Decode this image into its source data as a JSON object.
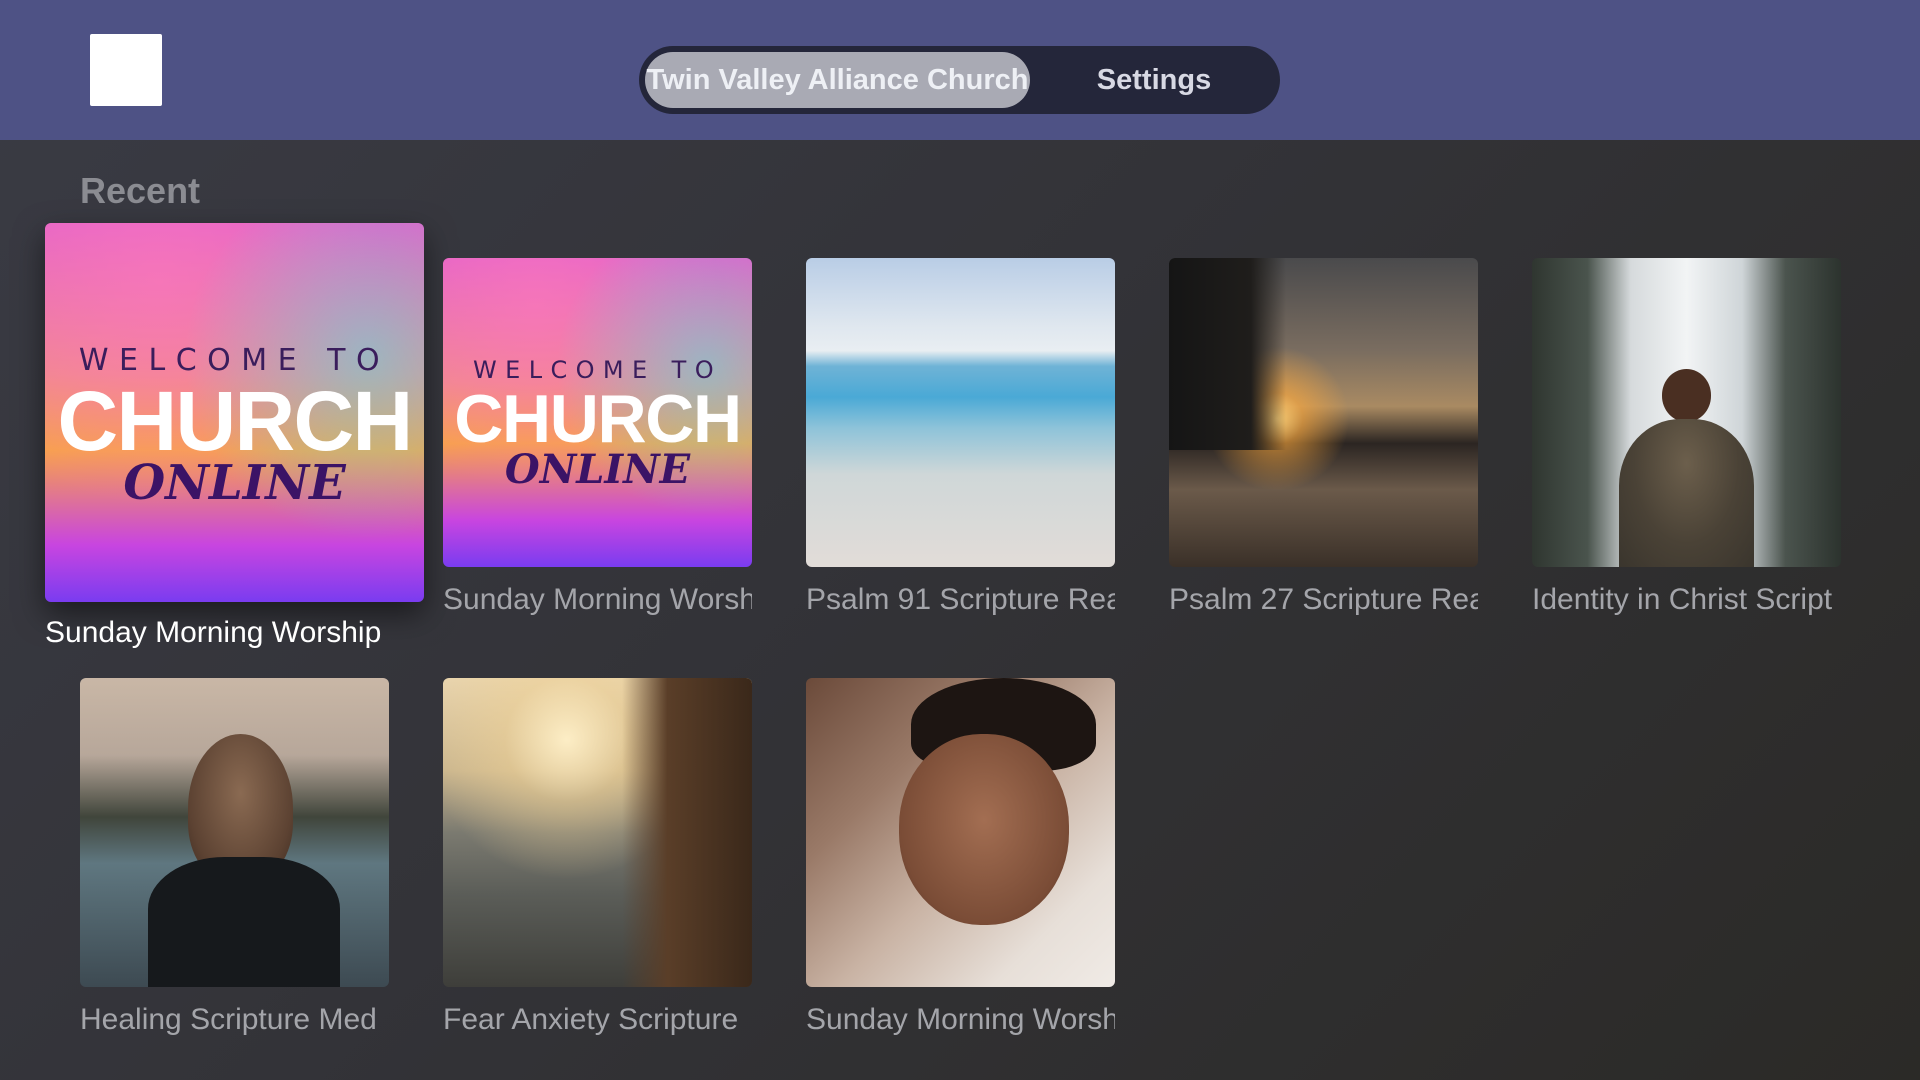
{
  "header": {
    "tabs": [
      {
        "label": "Twin Valley Alliance Church",
        "selected": true
      },
      {
        "label": "Settings",
        "selected": false
      }
    ]
  },
  "recent": {
    "title": "Recent",
    "items": [
      {
        "title": "Sunday Morning Worship",
        "art": "church",
        "focused": true,
        "art_text": {
          "welcome": "WELCOME TO",
          "church": "CHURCH",
          "online": "ONLINE"
        }
      },
      {
        "title": "Sunday Morning Worsh",
        "art": "church",
        "art_text": {
          "welcome": "WELCOME TO",
          "church": "CHURCH",
          "online": "ONLINE"
        }
      },
      {
        "title": "Psalm 91 Scripture Rea",
        "art": "beach"
      },
      {
        "title": "Psalm 27 Scripture Rea",
        "art": "sunset"
      },
      {
        "title": "Identity in Christ Script",
        "art": "waterfall"
      },
      {
        "title": "Healing Scripture Med",
        "art": "lake"
      },
      {
        "title": "Fear Anxiety Scripture",
        "art": "sea"
      },
      {
        "title": "Sunday Morning Worsh",
        "art": "couple"
      }
    ]
  }
}
